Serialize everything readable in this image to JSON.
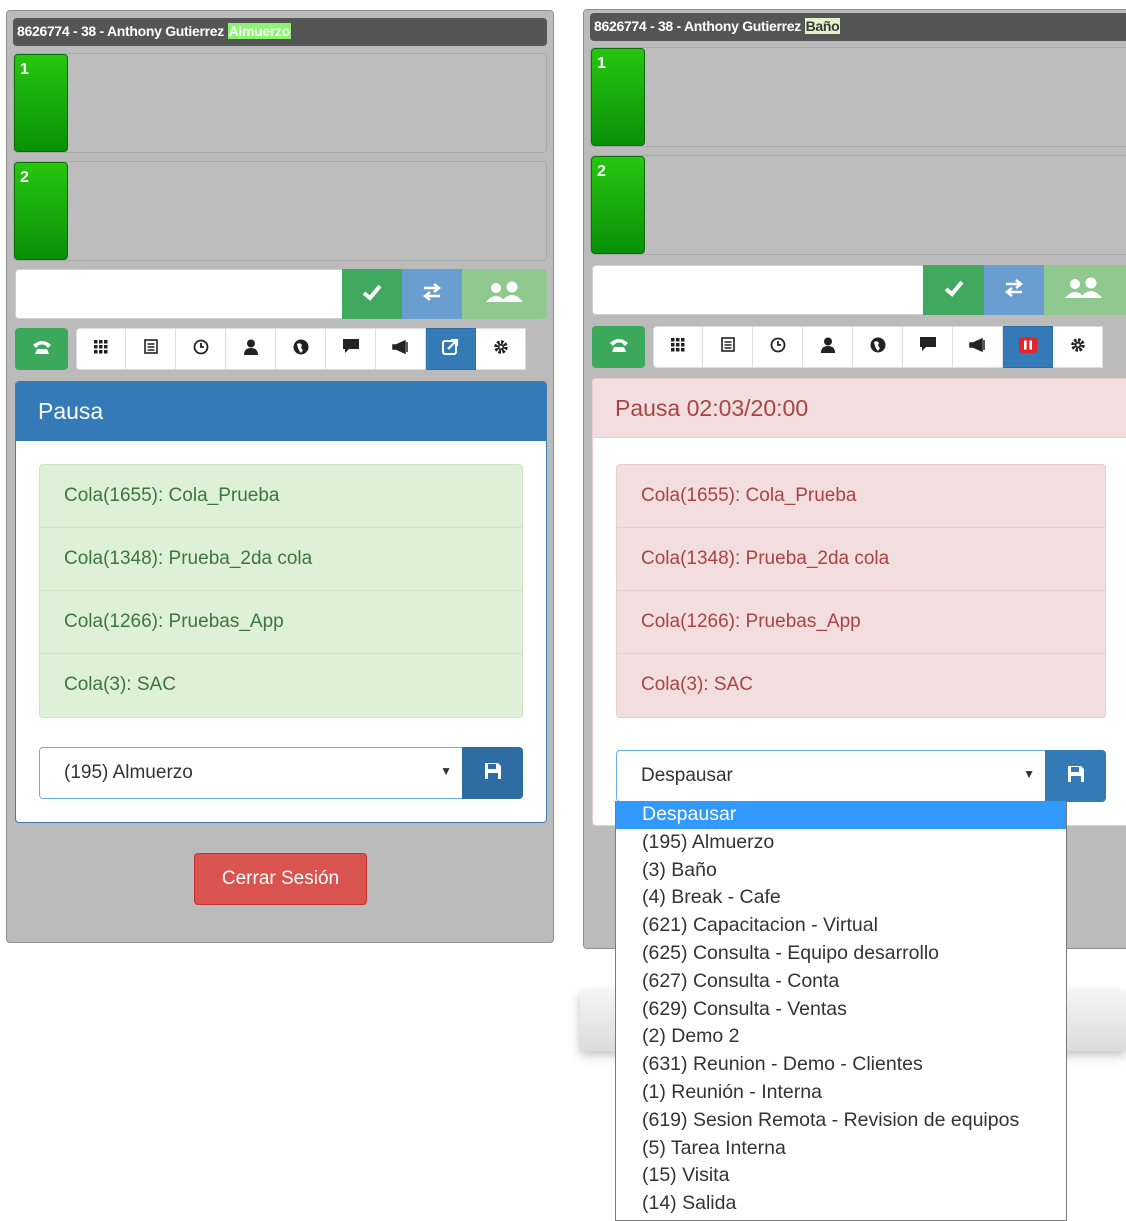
{
  "left": {
    "agent_info": "8626774 - 38 - Anthony Gutierrez",
    "status_tag": "Almuerzo",
    "lines": [
      "1",
      "2"
    ],
    "pause_title": "Pausa",
    "queues": [
      "Cola(1655): Cola_Prueba",
      "Cola(1348): Prueba_2da cola",
      "Cola(1266): Pruebas_App",
      "Cola(3): SAC"
    ],
    "select_value": "(195) Almuerzo",
    "logout_label": "Cerrar Sesión"
  },
  "right": {
    "agent_info": "8626774 - 38 - Anthony Gutierrez",
    "status_tag": "Baño",
    "lines": [
      "1",
      "2"
    ],
    "pause_title": "Pausa 02:03/20:00",
    "queues": [
      "Cola(1655): Cola_Prueba",
      "Cola(1348): Prueba_2da cola",
      "Cola(1266): Pruebas_App",
      "Cola(3): SAC"
    ],
    "select_value": "Despausar",
    "options": [
      "Despausar",
      "(195) Almuerzo",
      "(3) Baño",
      "(4) Break - Cafe",
      "(621) Capacitacion - Virtual",
      "(625) Consulta - Equipo desarrollo",
      "(627) Consulta - Conta",
      "(629) Consulta - Ventas",
      "(2) Demo 2",
      "(631) Reunion - Demo - Clientes",
      "(1) Reunión - Interna",
      "(619) Sesion Remota - Revision de equipos",
      "(5) Tarea Interna",
      "(15) Visita",
      "(14) Salida"
    ]
  },
  "icons": [
    "phone-icon",
    "keypad-icon",
    "list-icon",
    "clock-icon",
    "user-icon",
    "globe-icon",
    "chat-icon",
    "megaphone-icon",
    "logout-icon",
    "gear-icon",
    "pause-icon",
    "check-icon",
    "transfer-icon",
    "conference-icon",
    "save-icon"
  ],
  "colors": {
    "primary": "#337ab7",
    "success": "#5cb85c",
    "danger": "#d9534f",
    "queue_green_bg": "#dff0d8",
    "queue_red_bg": "#f2dede"
  }
}
